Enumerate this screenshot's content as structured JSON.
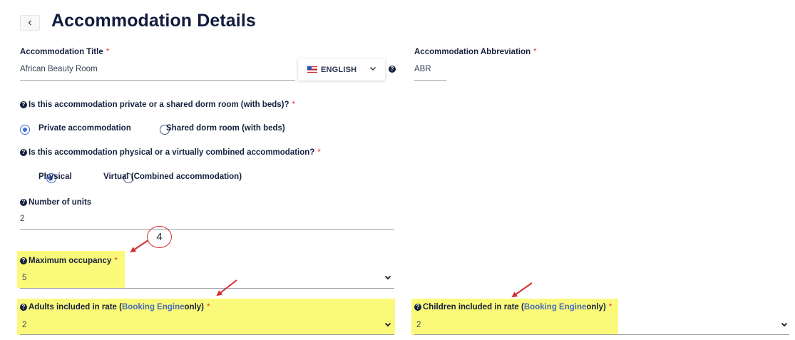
{
  "header": {
    "title": "Accommodation Details"
  },
  "form": {
    "title_field": {
      "label": "Accommodation Title",
      "required": "*",
      "value": "African Beauty Room"
    },
    "language": {
      "selected": "ENGLISH"
    },
    "abbreviation_field": {
      "label": "Accommodation Abbreviation",
      "required": "*",
      "value": "ABR"
    },
    "room_type": {
      "question": "Is this accommodation private or a shared dorm room (with beds)?",
      "required": "*",
      "options": [
        {
          "label": "Private accommodation",
          "checked": true
        },
        {
          "label": "Shared dorm room (with beds)",
          "checked": false
        }
      ]
    },
    "physical_type": {
      "question": "Is this accommodation physical or a virtually combined accommodation?",
      "required": "*",
      "options": [
        {
          "label": "Physical",
          "checked": true
        },
        {
          "label": "Virtual (Combined accommodation)",
          "checked": false
        }
      ]
    },
    "units": {
      "label": "Number of units",
      "value": "2"
    },
    "max_occupancy": {
      "label": "Maximum occupancy",
      "required": "*",
      "value": "5"
    },
    "adults": {
      "label_prefix": "Adults included in rate (",
      "label_link": "Booking Engine",
      "label_suffix": " only)",
      "required": "*",
      "value": "2"
    },
    "children": {
      "label_prefix": "Children included in rate (",
      "label_link": "Booking Engine",
      "label_suffix": " only)",
      "required": "*",
      "value": "2"
    }
  },
  "annotation": {
    "number": "4"
  },
  "icons": {
    "back": "chevron-left-icon",
    "help": "question-circle-icon",
    "flag": "us-flag-icon",
    "dropdown": "chevron-down-icon"
  },
  "colors": {
    "highlight": "#fbf97a",
    "radio_active": "#3f6ad8",
    "required": "#e53935",
    "annotation": "#d32f2f",
    "link": "#4a6fb5"
  }
}
